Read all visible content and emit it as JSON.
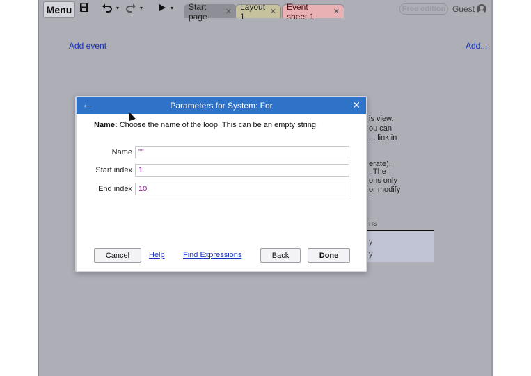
{
  "toolbar": {
    "menu_label": "Menu",
    "tabs": [
      {
        "label": "Start page",
        "color": "#8e8e96"
      },
      {
        "label": "Layout 1",
        "color": "#c6c29e"
      },
      {
        "label": "Event sheet 1",
        "color": "#e9b1b4"
      }
    ],
    "edition_badge": "Free edition",
    "guest_label": "Guest",
    "icons": [
      "save-icon",
      "undo-icon",
      "redo-icon",
      "play-icon",
      "user-icon"
    ]
  },
  "sheet": {
    "add_event_label": "Add event",
    "add_link_label": "Add...",
    "partial_lines": [
      "is view.",
      "ou can",
      "... link in",
      "erate),",
      ". The",
      "ons only",
      "or modify",
      "."
    ],
    "panel_header": "ns",
    "panel_rows": [
      "y",
      "y"
    ]
  },
  "dialog": {
    "title": "Parameters for System: For",
    "description_label": "Name:",
    "description_text": "Choose the name of the loop. This can be an empty string.",
    "params": [
      {
        "label": "Name",
        "value": "\"\""
      },
      {
        "label": "Start index",
        "value": "1"
      },
      {
        "label": "End index",
        "value": "10"
      }
    ],
    "buttons": {
      "cancel": "Cancel",
      "help": "Help",
      "find_expressions": "Find Expressions",
      "back": "Back",
      "done": "Done"
    },
    "colors": {
      "header": "#2e73c8",
      "value_text": "#8a1a8a",
      "link": "#1a33c5"
    }
  }
}
